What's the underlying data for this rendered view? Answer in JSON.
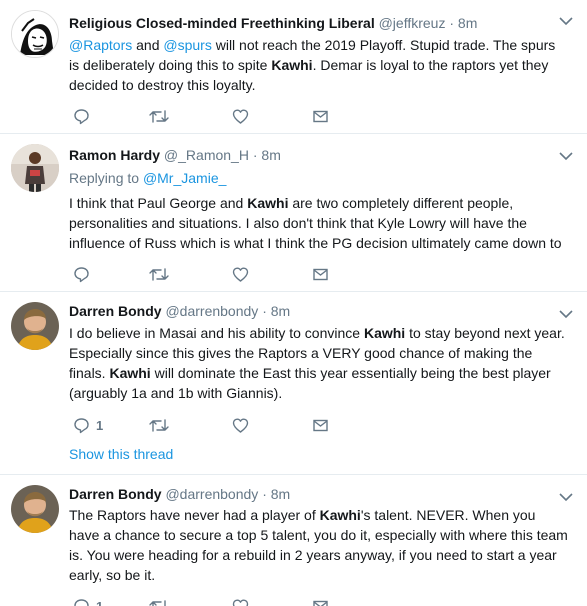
{
  "tweets": [
    {
      "name": "Religious Closed-minded Freethinking Liberal",
      "handle": "@jeffkreuz",
      "dot": "·",
      "time": "8m",
      "segments": [
        {
          "t": "@Raptors",
          "k": "link"
        },
        {
          "t": " and ",
          "k": ""
        },
        {
          "t": "@spurs",
          "k": "link"
        },
        {
          "t": " will not reach the 2019 Playoff. Stupid trade. The spurs is deliberately doing this to spite ",
          "k": ""
        },
        {
          "t": "Kawhi",
          "k": "b"
        },
        {
          "t": ". Demar is loyal to the raptors yet they decided to destroy this loyalty.",
          "k": ""
        }
      ]
    },
    {
      "name": "Ramon Hardy",
      "handle": "@_Ramon_H",
      "dot": "·",
      "time": "8m",
      "replying_prefix": "Replying to ",
      "replying_to": "@Mr_Jamie_",
      "segments": [
        {
          "t": "I think that Paul George and ",
          "k": ""
        },
        {
          "t": "Kawhi",
          "k": "b"
        },
        {
          "t": " are two completely different people, personalities and situations. I also don't think that Kyle Lowry will have the influence of Russ which is what I think the PG decision ultimately came down to",
          "k": ""
        }
      ]
    },
    {
      "name": "Darren Bondy",
      "handle": "@darrenbondy",
      "dot": "·",
      "time": "8m",
      "reply_count": "1",
      "show_thread": "Show this thread",
      "segments": [
        {
          "t": "I do believe in Masai and his ability to convince ",
          "k": ""
        },
        {
          "t": "Kawhi",
          "k": "b"
        },
        {
          "t": " to stay beyond next year. Especially since this gives the Raptors a VERY good chance of making the finals. ",
          "k": ""
        },
        {
          "t": "Kawhi",
          "k": "b"
        },
        {
          "t": " will dominate the East this year essentially being the best player (arguably 1a and 1b with Giannis).",
          "k": ""
        }
      ]
    },
    {
      "name": "Darren Bondy",
      "handle": "@darrenbondy",
      "dot": "·",
      "time": "8m",
      "reply_count": "1",
      "segments": [
        {
          "t": "The Raptors have never had a player of ",
          "k": ""
        },
        {
          "t": "Kawhi",
          "k": "b"
        },
        {
          "t": "'s talent. NEVER. When you have a chance to secure a top 5 talent, you do it, especially with where this team is. You were heading for a rebuild in 2 years anyway, if you need to start a year early, so be it.",
          "k": ""
        }
      ]
    }
  ],
  "icons": {
    "reply": "reply-icon",
    "retweet": "retweet-icon",
    "like": "heart-icon",
    "dm": "envelope-icon",
    "caret": "chevron-down-icon"
  },
  "colors": {
    "text": "#14171a",
    "secondary": "#657786",
    "link": "#1b95e0",
    "divider": "#e6ecf0"
  }
}
